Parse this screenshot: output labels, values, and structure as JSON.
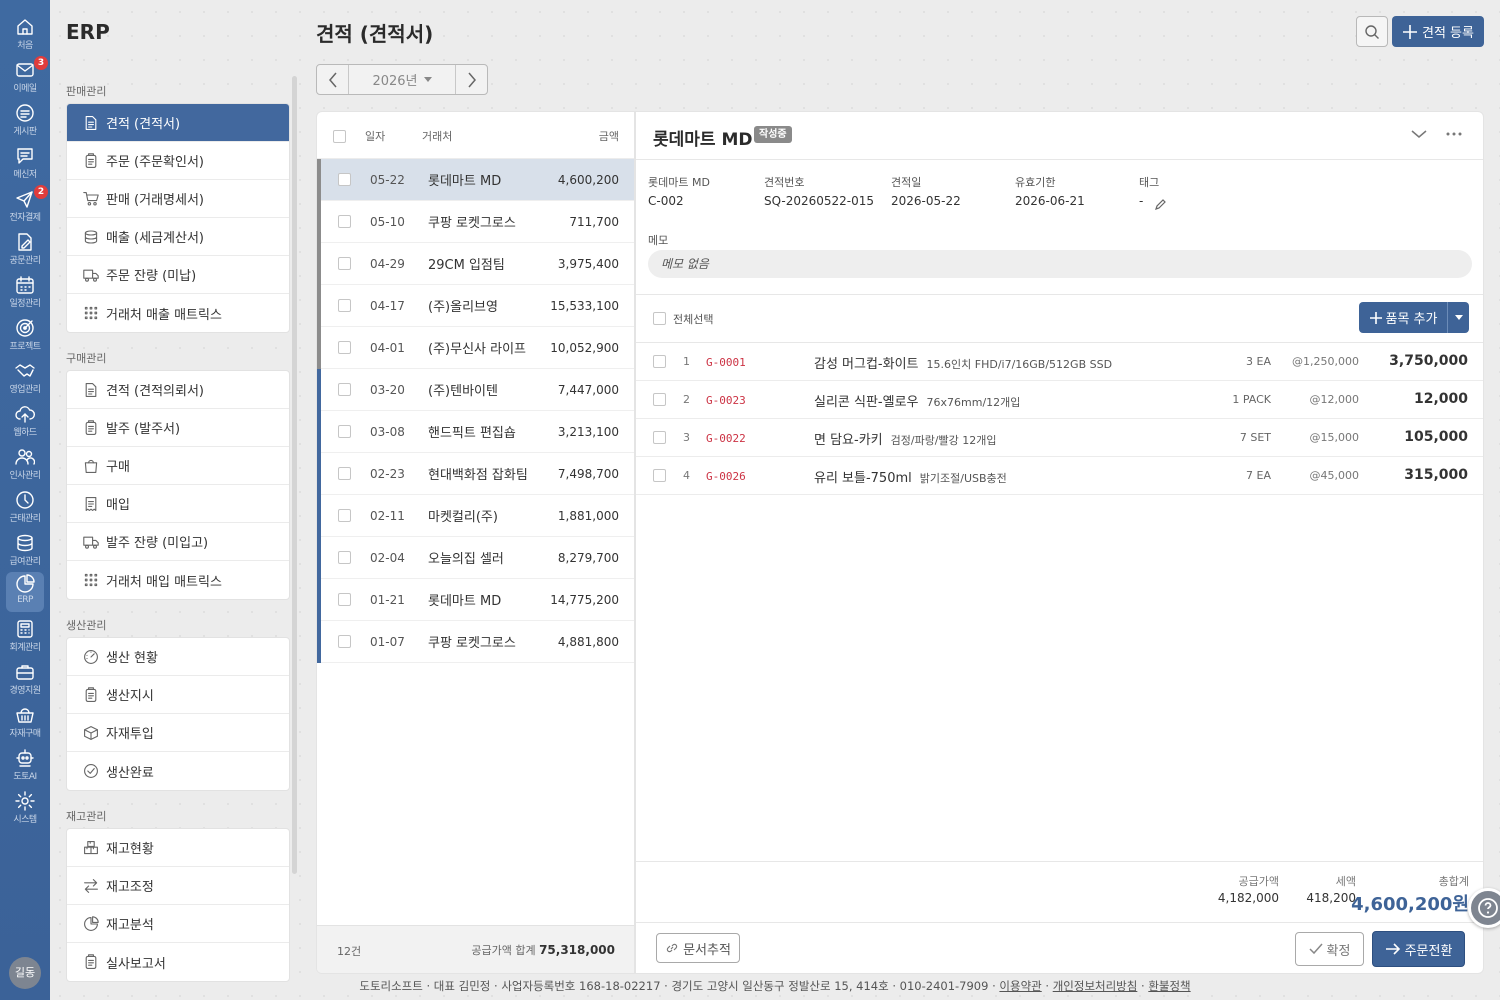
{
  "app_title": "ERP",
  "page_title": "견적 (견적서)",
  "header": {
    "add_button": "견적 등록"
  },
  "year_nav": {
    "label": "2026년"
  },
  "rail": {
    "items": [
      {
        "label": "처음",
        "icon": "home-icon"
      },
      {
        "label": "이메일",
        "icon": "mail-icon",
        "badge": "3"
      },
      {
        "label": "게시판",
        "icon": "board-icon"
      },
      {
        "label": "메신저",
        "icon": "messenger-icon"
      },
      {
        "label": "전자결제",
        "icon": "send-icon",
        "badge": "2"
      },
      {
        "label": "공문관리",
        "icon": "document-edit-icon"
      },
      {
        "label": "일정관리",
        "icon": "calendar-icon"
      },
      {
        "label": "프로젝트",
        "icon": "target-icon"
      },
      {
        "label": "영업관리",
        "icon": "handshake-icon"
      },
      {
        "label": "웹하드",
        "icon": "cloud-upload-icon"
      },
      {
        "label": "인사관리",
        "icon": "people-icon"
      },
      {
        "label": "근태관리",
        "icon": "clock-icon"
      },
      {
        "label": "급여관리",
        "icon": "coins-icon"
      },
      {
        "label": "ERP",
        "icon": "pie-chart-icon",
        "active": true
      },
      {
        "label": "회계관리",
        "icon": "calculator-icon"
      },
      {
        "label": "경영지원",
        "icon": "briefcase-icon"
      },
      {
        "label": "자재구매",
        "icon": "basket-icon"
      },
      {
        "label": "도토AI",
        "icon": "robot-icon"
      },
      {
        "label": "시스템",
        "icon": "gear-icon"
      }
    ],
    "avatar": "길동"
  },
  "sidebar": {
    "sections": [
      {
        "title": "판매관리",
        "items": [
          {
            "label": "견적 (견적서)",
            "icon": "document-icon",
            "active": true
          },
          {
            "label": "주문 (주문확인서)",
            "icon": "clipboard-icon"
          },
          {
            "label": "판매 (거래명세서)",
            "icon": "cart-icon"
          },
          {
            "label": "매출 (세금계산서)",
            "icon": "coins-icon"
          },
          {
            "label": "주문 잔량 (미납)",
            "icon": "truck-icon"
          },
          {
            "label": "거래처 매출 매트릭스",
            "icon": "grid-icon"
          }
        ]
      },
      {
        "title": "구매관리",
        "items": [
          {
            "label": "견적 (견적의뢰서)",
            "icon": "document-icon"
          },
          {
            "label": "발주 (발주서)",
            "icon": "clipboard-icon"
          },
          {
            "label": "구매",
            "icon": "bag-icon"
          },
          {
            "label": "매입",
            "icon": "receipt-icon"
          },
          {
            "label": "발주 잔량 (미입고)",
            "icon": "truck-icon"
          },
          {
            "label": "거래처 매입 매트릭스",
            "icon": "grid-icon"
          }
        ]
      },
      {
        "title": "생산관리",
        "items": [
          {
            "label": "생산 현황",
            "icon": "gauge-icon"
          },
          {
            "label": "생산지시",
            "icon": "clipboard-icon"
          },
          {
            "label": "자재투입",
            "icon": "box-icon"
          },
          {
            "label": "생산완료",
            "icon": "check-circle-icon"
          }
        ]
      },
      {
        "title": "재고관리",
        "items": [
          {
            "label": "재고현황",
            "icon": "boxes-icon"
          },
          {
            "label": "재고조정",
            "icon": "arrows-icon"
          },
          {
            "label": "재고분석",
            "icon": "pie-chart-icon"
          },
          {
            "label": "실사보고서",
            "icon": "clipboard-icon"
          }
        ]
      }
    ]
  },
  "list": {
    "headers": {
      "date": "일자",
      "client": "거래처",
      "amount": "금액"
    },
    "rows": [
      {
        "date": "05-22",
        "client": "롯데마트 MD",
        "amount": "4,600,200",
        "bar": "#8c8c8c",
        "selected": true
      },
      {
        "date": "05-10",
        "client": "쿠팡 로켓그로스",
        "amount": "711,700",
        "bar": "#8c8c8c"
      },
      {
        "date": "04-29",
        "client": "29CM 입점팀",
        "amount": "3,975,400",
        "bar": "#8c8c8c"
      },
      {
        "date": "04-17",
        "client": "(주)올리브영",
        "amount": "15,533,100",
        "bar": "#8c8c8c"
      },
      {
        "date": "04-01",
        "client": "(주)무신사 라이프",
        "amount": "10,052,900",
        "bar": "#8c8c8c"
      },
      {
        "date": "03-20",
        "client": "(주)텐바이텐",
        "amount": "7,447,000",
        "bar": "#42689e"
      },
      {
        "date": "03-08",
        "client": "핸드픽트 편집숍",
        "amount": "3,213,100",
        "bar": "#42689e"
      },
      {
        "date": "02-23",
        "client": "현대백화점 잡화팀",
        "amount": "7,498,700",
        "bar": "#42689e"
      },
      {
        "date": "02-11",
        "client": "마켓컬리(주)",
        "amount": "1,881,000",
        "bar": "#42689e"
      },
      {
        "date": "02-04",
        "client": "오늘의집 셀러",
        "amount": "8,279,700",
        "bar": "#42689e"
      },
      {
        "date": "01-21",
        "client": "롯데마트 MD",
        "amount": "14,775,200",
        "bar": "#42689e"
      },
      {
        "date": "01-07",
        "client": "쿠팡 로켓그로스",
        "amount": "4,881,800",
        "bar": "#42689e"
      }
    ],
    "footer": {
      "count": "12건",
      "sum_label": "공급가액 합계",
      "sum_value": "75,318,000"
    }
  },
  "detail": {
    "title": "롯데마트 MD",
    "status": "작성중",
    "info": {
      "client_label": "롯데마트 MD",
      "client_code": "C-002",
      "quote_no_label": "견적번호",
      "quote_no": "SQ-20260522-015",
      "quote_date_label": "견적일",
      "quote_date": "2026-05-22",
      "valid_label": "유효기한",
      "valid_date": "2026-06-21",
      "tag_label": "태그",
      "tag_value": "-"
    },
    "memo_label": "메모",
    "memo": "메모 없음",
    "select_all": "전체선택",
    "add_item": "품목 추가",
    "items": [
      {
        "no": "1",
        "code": "G-0001",
        "name": "감성 머그컵-화이트",
        "spec": "15.6인치 FHD/i7/16GB/512GB SSD",
        "qty": "3 EA",
        "price": "@1,250,000",
        "total": "3,750,000"
      },
      {
        "no": "2",
        "code": "G-0023",
        "name": "실리콘 식판-옐로우",
        "spec": "76x76mm/12개입",
        "qty": "1 PACK",
        "price": "@12,000",
        "total": "12,000"
      },
      {
        "no": "3",
        "code": "G-0022",
        "name": "면 담요-카키",
        "spec": "검정/파랑/빨강 12개입",
        "qty": "7 SET",
        "price": "@15,000",
        "total": "105,000"
      },
      {
        "no": "4",
        "code": "G-0026",
        "name": "유리 보틀-750ml",
        "spec": "밝기조절/USB충전",
        "qty": "7 EA",
        "price": "@45,000",
        "total": "315,000"
      }
    ],
    "totals": {
      "supply_label": "공급가액",
      "supply": "4,182,000",
      "tax_label": "세액",
      "tax": "418,200",
      "grand_label": "총합계",
      "grand": "4,600,200원"
    },
    "buttons": {
      "trace": "문서추적",
      "confirm": "확정",
      "convert": "주문전환"
    }
  },
  "footer": {
    "company": "도토리소프트 · 대표 김민정 · 사업자등록번호 168-18-02217 · 경기도 고양시 일산동구 정발산로 15, 414호 · 010-2401-7909 ·",
    "terms": "이용약관",
    "privacy": "개인정보처리방침",
    "refund": "환불정책"
  }
}
